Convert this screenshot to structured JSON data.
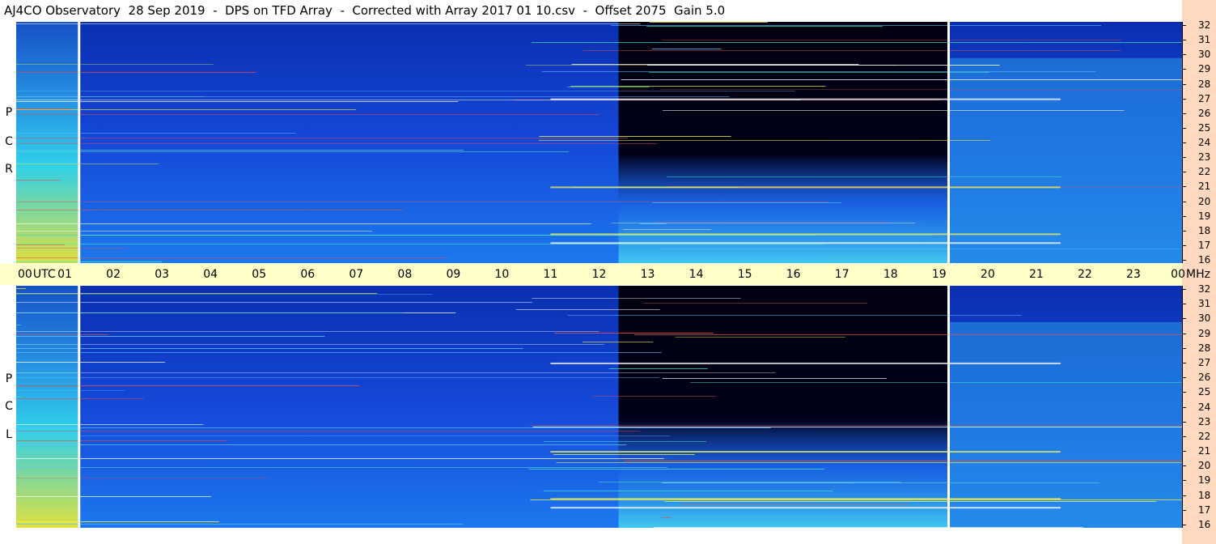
{
  "title": "AJ4CO Observatory  28 Sep 2019  -  DPS on TFD Array  -  Corrected with Array 2017 01 10.csv  -  Offset 2075  Gain 5.0",
  "panels": {
    "top": {
      "polarization_letters": [
        "R",
        "C",
        "P"
      ]
    },
    "bottom": {
      "polarization_letters": [
        "L",
        "C",
        "P"
      ]
    }
  },
  "colors": {
    "background_blue": "#1550e0",
    "dark_region": "#000010",
    "axis_strip": "#ffffc8",
    "side_strip": "#ffd9bf",
    "marker_line": "#ffffff"
  },
  "chart_data": {
    "type": "heatmap",
    "x_unit": "UTC",
    "x_ticks": [
      "00",
      "01",
      "02",
      "03",
      "04",
      "05",
      "06",
      "07",
      "08",
      "09",
      "10",
      "11",
      "12",
      "13",
      "14",
      "15",
      "16",
      "17",
      "18",
      "19",
      "20",
      "21",
      "22",
      "23",
      "00"
    ],
    "x_axis_label": "UTC",
    "x_range_hours": [
      0,
      24
    ],
    "y_unit": "MHz",
    "y_ticks": [
      "32",
      "31",
      "30",
      "29",
      "28",
      "27",
      "26",
      "25",
      "24",
      "23",
      "22",
      "21",
      "20",
      "19",
      "18",
      "17",
      "16"
    ],
    "y_range_mhz": [
      16,
      32
    ],
    "panels": [
      "RCP",
      "LCP"
    ],
    "vertical_markers_utc": [
      1.27,
      19.17
    ]
  }
}
